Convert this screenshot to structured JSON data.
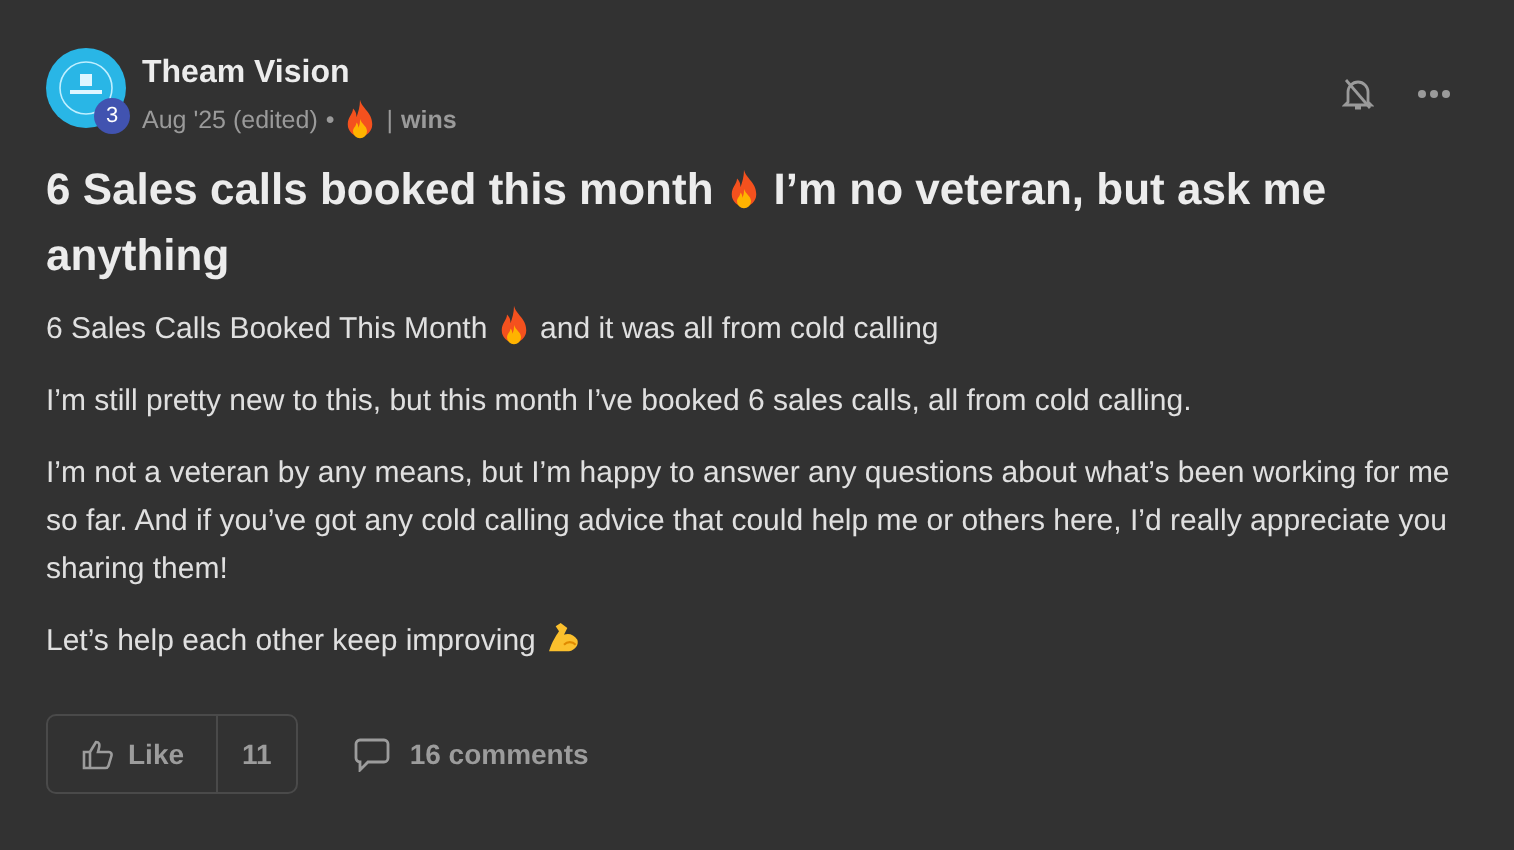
{
  "post": {
    "author": "Theam Vision",
    "level_badge": "3",
    "date": "Aug '25 (edited)",
    "separator": "•",
    "divider": "|",
    "category": "wins",
    "title": [
      {
        "kind": "text",
        "text": "6 Sales calls booked this month"
      },
      {
        "kind": "fire"
      },
      {
        "kind": "text",
        "text": "I’m no veteran, but ask me"
      },
      {
        "kind": "text",
        "text": "anything"
      }
    ],
    "paragraphs": [
      {
        "kind": "fire",
        "text": "6 Sales Calls Booked This Month",
        "text_after": "and it was all from cold calling"
      },
      {
        "kind": "plain",
        "text": "I’m still pretty new to this, but this month I’ve booked 6 sales calls, all from cold calling."
      },
      {
        "kind": "plain",
        "text": "I’m not a veteran by any means, but I’m happy to answer any questions about what’s been working for me so far. And if you’ve got any cold calling advice that could help me or others here, I’d really appreciate you sharing them!"
      },
      {
        "kind": "muscle",
        "text": "Let’s help each other keep improving"
      }
    ],
    "like_label": "Like",
    "like_count": "11",
    "comments": "16 comments"
  }
}
